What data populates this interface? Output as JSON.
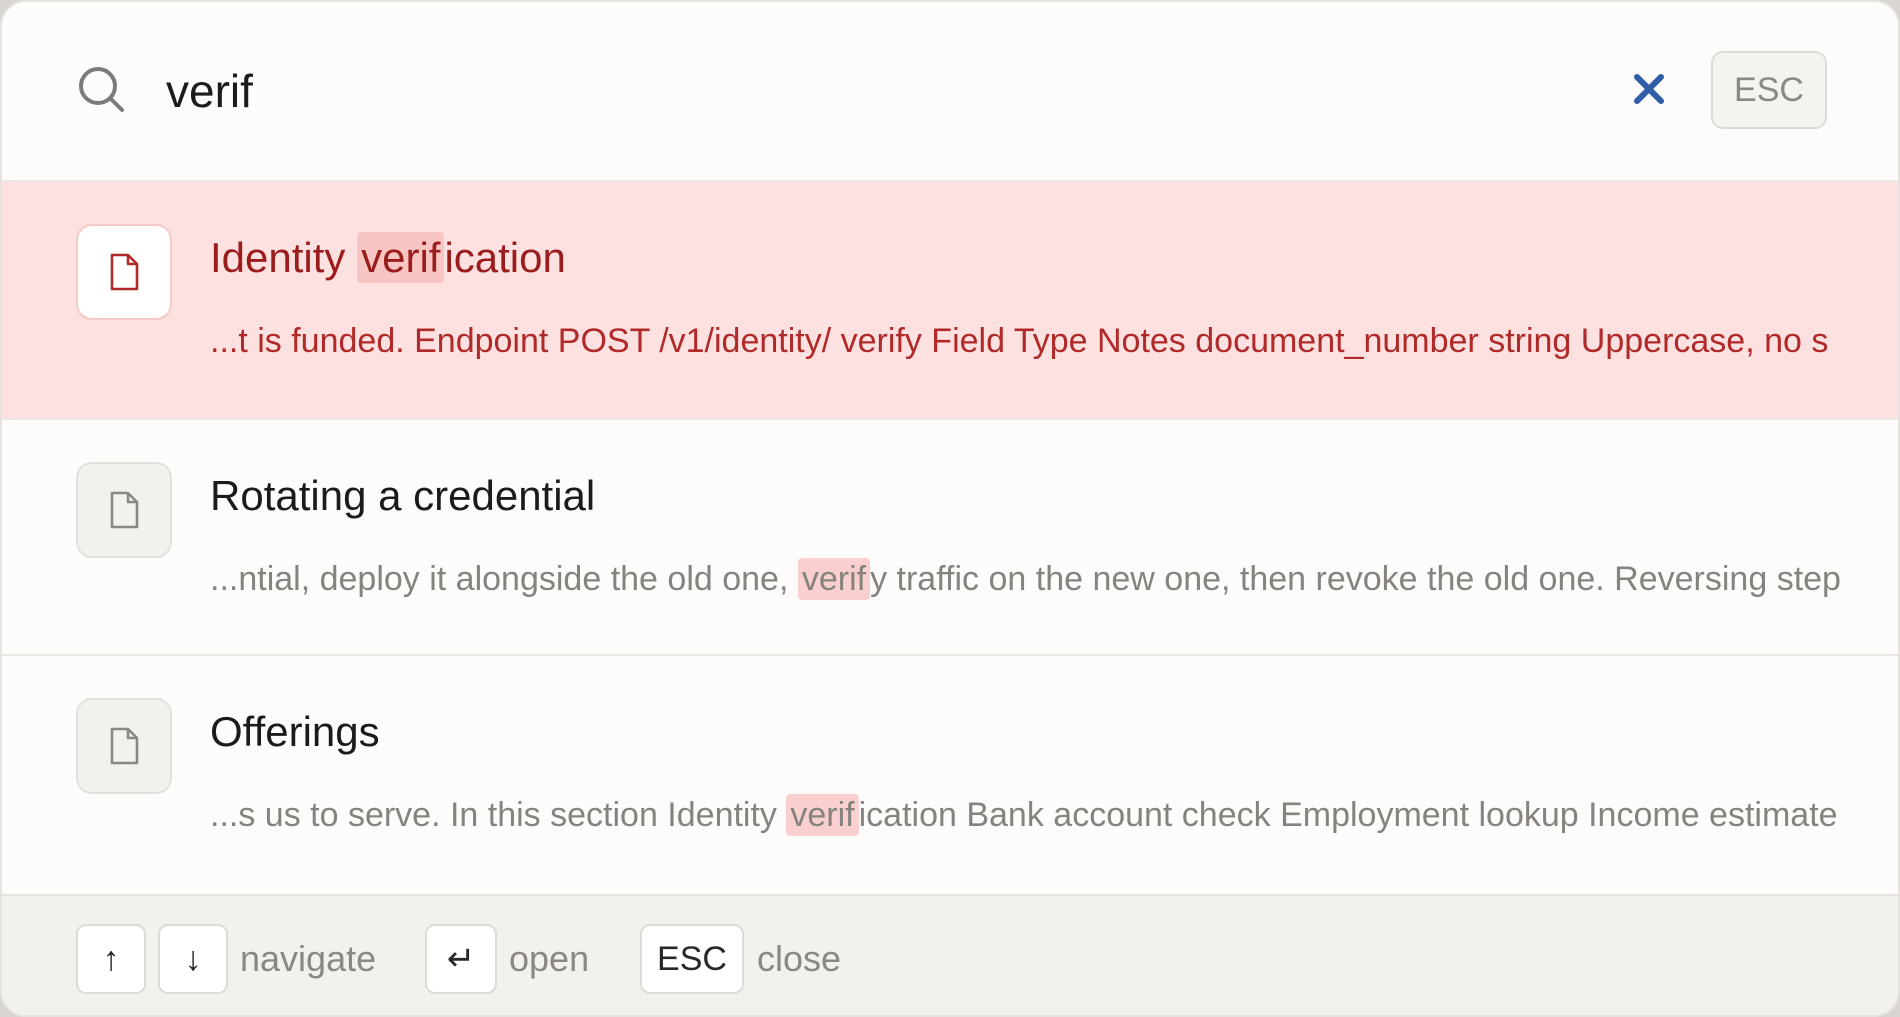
{
  "search": {
    "value": "verif",
    "clear_label": "×",
    "esc_label": "ESC"
  },
  "results": [
    {
      "title_before": "Identity ",
      "title_match": "verif",
      "title_after": "ication",
      "snippet_before": "...t is funded. Endpoint POST /v1/identity/ ",
      "snippet_match": "verif",
      "snippet_after": "y Field Type Notes document_number string Uppercase, no s",
      "selected": true
    },
    {
      "title": "Rotating a credential",
      "snippet_before": "...ntial, deploy it alongside the old one, ",
      "snippet_match": "verif",
      "snippet_after": "y traffic on the new one, then revoke the old one. Reversing step"
    },
    {
      "title": "Offerings",
      "snippet_before": "...s us to serve. In this section Identity ",
      "snippet_match": "verif",
      "snippet_after": "ication Bank account check Employment lookup Income estimate"
    }
  ],
  "footer": {
    "up_key": "↑",
    "down_key": "↓",
    "navigate_label": "navigate",
    "enter_key": "↵",
    "open_label": "open",
    "esc_key": "ESC",
    "close_label": "close"
  },
  "colors": {
    "selected_bg": "#fde1e0",
    "selected_text": "#9b1c1c",
    "highlight_bg": "#f9d0cf",
    "clear_icon": "#2f5da8"
  },
  "icons": {
    "search": "search-icon",
    "clear": "close-icon",
    "result": "document-icon"
  }
}
